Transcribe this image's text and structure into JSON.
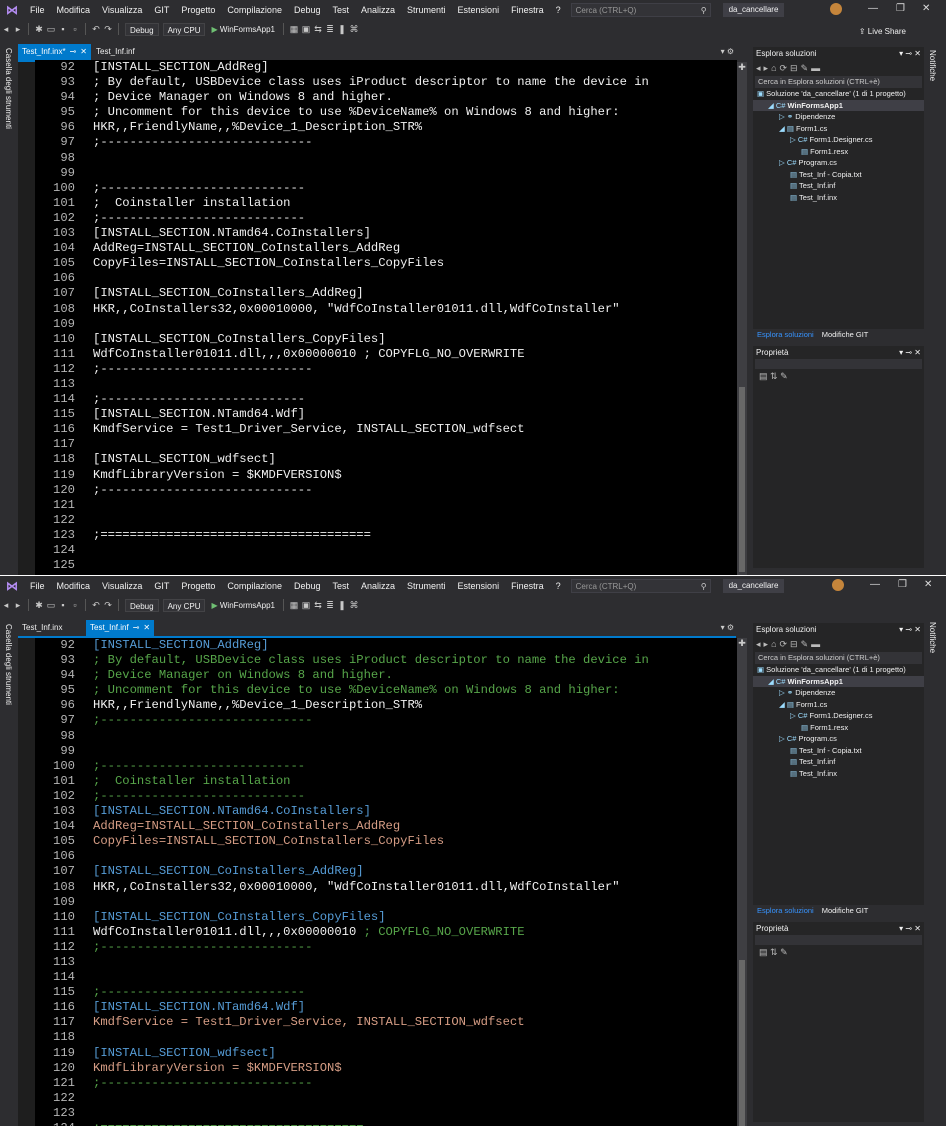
{
  "menu": [
    "File",
    "Modifica",
    "Visualizza",
    "GIT",
    "Progetto",
    "Compilazione",
    "Debug",
    "Test",
    "Analizza",
    "Strumenti",
    "Estensioni",
    "Finestra",
    "?"
  ],
  "search_placeholder": "Cerca (CTRL+Q)",
  "solution_badge": "da_cancellare",
  "toolbar": {
    "config": "Debug",
    "platform": "Any CPU",
    "start": "WinFormsApp1"
  },
  "live_share": "Live Share",
  "toolbox_label": "Casella degli strumenti",
  "notifications_label": "Notifiche",
  "win1": {
    "tabs": [
      {
        "label": "Test_Inf.inx*",
        "active": true
      },
      {
        "label": "Test_Inf.inf",
        "active": false
      }
    ],
    "lines": [
      {
        "n": "92",
        "t": "[INSTALL_SECTION_AddReg]"
      },
      {
        "n": "93",
        "t": "; By default, USBDevice class uses iProduct descriptor to name the device in"
      },
      {
        "n": "94",
        "t": "; Device Manager on Windows 8 and higher."
      },
      {
        "n": "95",
        "t": "; Uncomment for this device to use %DeviceName% on Windows 8 and higher:"
      },
      {
        "n": "96",
        "t": "HKR,,FriendlyName,,%Device_1_Description_STR%"
      },
      {
        "n": "97",
        "t": ";-----------------------------"
      },
      {
        "n": "98",
        "t": ""
      },
      {
        "n": "99",
        "t": ""
      },
      {
        "n": "100",
        "t": ";----------------------------"
      },
      {
        "n": "101",
        "t": ";  Coinstaller installation"
      },
      {
        "n": "102",
        "t": ";----------------------------"
      },
      {
        "n": "103",
        "t": "[INSTALL_SECTION.NTamd64.CoInstallers]"
      },
      {
        "n": "104",
        "t": "AddReg=INSTALL_SECTION_CoInstallers_AddReg"
      },
      {
        "n": "105",
        "t": "CopyFiles=INSTALL_SECTION_CoInstallers_CopyFiles"
      },
      {
        "n": "106",
        "t": ""
      },
      {
        "n": "107",
        "t": "[INSTALL_SECTION_CoInstallers_AddReg]"
      },
      {
        "n": "108",
        "t": "HKR,,CoInstallers32,0x00010000, \"WdfCoInstaller01011.dll,WdfCoInstaller\""
      },
      {
        "n": "109",
        "t": ""
      },
      {
        "n": "110",
        "t": "[INSTALL_SECTION_CoInstallers_CopyFiles]"
      },
      {
        "n": "111",
        "t": "WdfCoInstaller01011.dll,,,0x00000010 ; COPYFLG_NO_OVERWRITE"
      },
      {
        "n": "112",
        "t": ";-----------------------------"
      },
      {
        "n": "113",
        "t": ""
      },
      {
        "n": "114",
        "t": ";----------------------------"
      },
      {
        "n": "115",
        "t": "[INSTALL_SECTION.NTamd64.Wdf]"
      },
      {
        "n": "116",
        "t": "KmdfService = Test1_Driver_Service, INSTALL_SECTION_wdfsect"
      },
      {
        "n": "117",
        "t": ""
      },
      {
        "n": "118",
        "t": "[INSTALL_SECTION_wdfsect]"
      },
      {
        "n": "119",
        "t": "KmdfLibraryVersion = $KMDFVERSION$"
      },
      {
        "n": "120",
        "t": ";-----------------------------"
      },
      {
        "n": "121",
        "t": ""
      },
      {
        "n": "122",
        "t": ""
      },
      {
        "n": "123",
        "t": ";====================================="
      },
      {
        "n": "124",
        "t": ""
      },
      {
        "n": "125",
        "t": ""
      }
    ]
  },
  "win2": {
    "tabs": [
      {
        "label": "Test_Inf.inx",
        "active": false
      },
      {
        "label": "Test_Inf.inf",
        "active": true
      }
    ],
    "lines": [
      {
        "n": "92",
        "t": "[INSTALL_SECTION_AddReg]",
        "c": "sec"
      },
      {
        "n": "93",
        "t": "; By default, USBDevice class uses iProduct descriptor to name the device in",
        "c": "com"
      },
      {
        "n": "94",
        "t": "; Device Manager on Windows 8 and higher.",
        "c": "com"
      },
      {
        "n": "95",
        "t": "; Uncomment for this device to use %DeviceName% on Windows 8 and higher:",
        "c": "com"
      },
      {
        "n": "96",
        "t": "HKR,,FriendlyName,,%Device_1_Description_STR%",
        "c": "txt"
      },
      {
        "n": "97",
        "t": ";-----------------------------",
        "c": "com"
      },
      {
        "n": "98",
        "t": "",
        "c": "txt"
      },
      {
        "n": "99",
        "t": "",
        "c": "txt"
      },
      {
        "n": "100",
        "t": ";----------------------------",
        "c": "com"
      },
      {
        "n": "101",
        "t": ";  Coinstaller installation",
        "c": "com"
      },
      {
        "n": "102",
        "t": ";----------------------------",
        "c": "com"
      },
      {
        "n": "103",
        "t": "[INSTALL_SECTION.NTamd64.CoInstallers]",
        "c": "sec"
      },
      {
        "n": "104",
        "t": "AddReg=INSTALL_SECTION_CoInstallers_AddReg",
        "c": "key"
      },
      {
        "n": "105",
        "t": "CopyFiles=INSTALL_SECTION_CoInstallers_CopyFiles",
        "c": "key"
      },
      {
        "n": "106",
        "t": "",
        "c": "txt"
      },
      {
        "n": "107",
        "t": "[INSTALL_SECTION_CoInstallers_AddReg]",
        "c": "sec"
      },
      {
        "n": "108",
        "t": "HKR,,CoInstallers32,0x00010000, \"WdfCoInstaller01011.dll,WdfCoInstaller\"",
        "c": "txt"
      },
      {
        "n": "109",
        "t": "",
        "c": "txt"
      },
      {
        "n": "110",
        "t": "[INSTALL_SECTION_CoInstallers_CopyFiles]",
        "c": "sec"
      },
      {
        "n": "111",
        "t": "WdfCoInstaller01011.dll,,,0x00000010 ; COPYFLG_NO_OVERWRITE",
        "c": "mix"
      },
      {
        "n": "112",
        "t": ";-----------------------------",
        "c": "com"
      },
      {
        "n": "113",
        "t": "",
        "c": "txt"
      },
      {
        "n": "114",
        "t": "",
        "c": "txt"
      },
      {
        "n": "115",
        "t": ";----------------------------",
        "c": "com"
      },
      {
        "n": "116",
        "t": "[INSTALL_SECTION.NTamd64.Wdf]",
        "c": "sec"
      },
      {
        "n": "117",
        "t": "KmdfService = Test1_Driver_Service, INSTALL_SECTION_wdfsect",
        "c": "key"
      },
      {
        "n": "118",
        "t": "",
        "c": "txt"
      },
      {
        "n": "119",
        "t": "[INSTALL_SECTION_wdfsect]",
        "c": "sec"
      },
      {
        "n": "120",
        "t": "KmdfLibraryVersion = $KMDFVERSION$",
        "c": "key"
      },
      {
        "n": "121",
        "t": ";-----------------------------",
        "c": "com"
      },
      {
        "n": "122",
        "t": "",
        "c": "txt"
      },
      {
        "n": "123",
        "t": "",
        "c": "txt"
      },
      {
        "n": "124",
        "t": ";====================================",
        "c": "com"
      }
    ]
  },
  "solution_explorer": {
    "title": "Esplora soluzioni",
    "search": "Cerca in Esplora soluzioni (CTRL+è)",
    "items": [
      {
        "label": "Soluzione 'da_cancellare' (1 di 1 progetto)",
        "indent": 0,
        "icon": "▣"
      },
      {
        "label": "WinFormsApp1",
        "indent": 1,
        "icon": "◢ C#",
        "bold": true
      },
      {
        "label": "Dipendenze",
        "indent": 2,
        "icon": "▷ ⚭"
      },
      {
        "label": "Form1.cs",
        "indent": 2,
        "icon": "◢ ▤"
      },
      {
        "label": "Form1.Designer.cs",
        "indent": 3,
        "icon": "▷ C#"
      },
      {
        "label": "Form1.resx",
        "indent": 4,
        "icon": "▤"
      },
      {
        "label": "Program.cs",
        "indent": 2,
        "icon": "▷ C#"
      },
      {
        "label": "Test_Inf - Copia.txt",
        "indent": 3,
        "icon": "▤"
      },
      {
        "label": "Test_Inf.inf",
        "indent": 3,
        "icon": "▤"
      },
      {
        "label": "Test_Inf.inx",
        "indent": 3,
        "icon": "▤"
      }
    ]
  },
  "bottom_tabs": [
    "Esplora soluzioni",
    "Modifiche GIT"
  ],
  "properties_title": "Proprietà",
  "colors": {
    "section": "#569cd6",
    "comment": "#57a64a",
    "key": "#d69d85",
    "text": "#f1f1f1",
    "accent": "#007acc"
  }
}
